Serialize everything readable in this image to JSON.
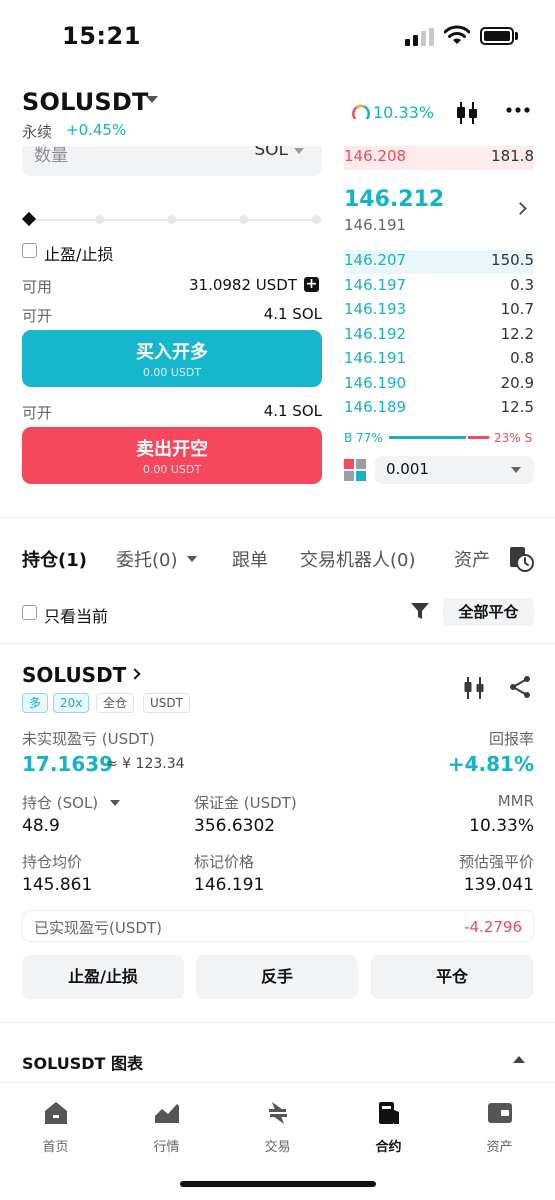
{
  "status": {
    "time": "15:21"
  },
  "header": {
    "symbol": "SOLUSDT",
    "contract_type": "永续",
    "change": "+0.45%",
    "funding_gauge": "10.33%"
  },
  "form": {
    "qty_label": "数量",
    "qty_unit": "SOL",
    "slider_position": 0,
    "tpsl_label": "止盈/止损",
    "available_label": "可用",
    "available_value": "31.0982 USDT",
    "open_label": "可开",
    "open_long_value": "4.1 SOL",
    "open_short_value": "4.1 SOL",
    "buy_button": "买入开多",
    "buy_amount": "0.00 USDT",
    "sell_button": "卖出开空",
    "sell_amount": "0.00 USDT"
  },
  "orderbook": {
    "asks": [
      {
        "price": "146.208",
        "qty": "181.8"
      }
    ],
    "last_price": "146.212",
    "mark_price": "146.191",
    "bids": [
      {
        "price": "146.207",
        "qty": "150.5"
      },
      {
        "price": "146.197",
        "qty": "0.3"
      },
      {
        "price": "146.193",
        "qty": "10.7"
      },
      {
        "price": "146.192",
        "qty": "12.2"
      },
      {
        "price": "146.191",
        "qty": "0.8"
      },
      {
        "price": "146.190",
        "qty": "20.9"
      },
      {
        "price": "146.189",
        "qty": "12.5"
      }
    ],
    "buy_ratio_label": "B 77%",
    "sell_ratio_label": "23% S",
    "buy_ratio": 77,
    "precision": "0.001"
  },
  "tabs": {
    "positions": "持仓(1)",
    "orders": "委托(0)",
    "copy": "跟单",
    "bots": "交易机器人(0)",
    "assets": "资产"
  },
  "filter": {
    "only_current": "只看当前",
    "close_all": "全部平仓"
  },
  "position": {
    "symbol": "SOLUSDT",
    "tags": [
      "多",
      "20x",
      "全仓",
      "USDT"
    ],
    "upnl_label": "未实现盈亏 (USDT)",
    "upnl_value": "17.1639",
    "upnl_fiat": "≈ ¥ 123.34",
    "roe_label": "回报率",
    "roe_value": "+4.81%",
    "size_label": "持仓 (SOL)",
    "size_value": "48.9",
    "margin_label": "保证金 (USDT)",
    "margin_value": "356.6302",
    "mmr_label": "MMR",
    "mmr_value": "10.33%",
    "entry_label": "持仓均价",
    "entry_value": "145.861",
    "mark_label": "标记价格",
    "mark_value": "146.191",
    "liq_label": "预估强平价",
    "liq_value": "139.041",
    "realized_label": "已实现盈亏(USDT)",
    "realized_value": "-4.2796",
    "btn_tpsl": "止盈/止损",
    "btn_reverse": "反手",
    "btn_close": "平仓"
  },
  "chart_section": {
    "title": "SOLUSDT  图表"
  },
  "nav": [
    {
      "label": "首页",
      "icon": "home-icon"
    },
    {
      "label": "行情",
      "icon": "market-icon"
    },
    {
      "label": "交易",
      "icon": "trade-icon"
    },
    {
      "label": "合约",
      "icon": "futures-icon"
    },
    {
      "label": "资产",
      "icon": "wallet-icon"
    }
  ],
  "colors": {
    "teal": "#14b3c8",
    "red": "#f14b5c",
    "orange": "#f2a53a"
  }
}
